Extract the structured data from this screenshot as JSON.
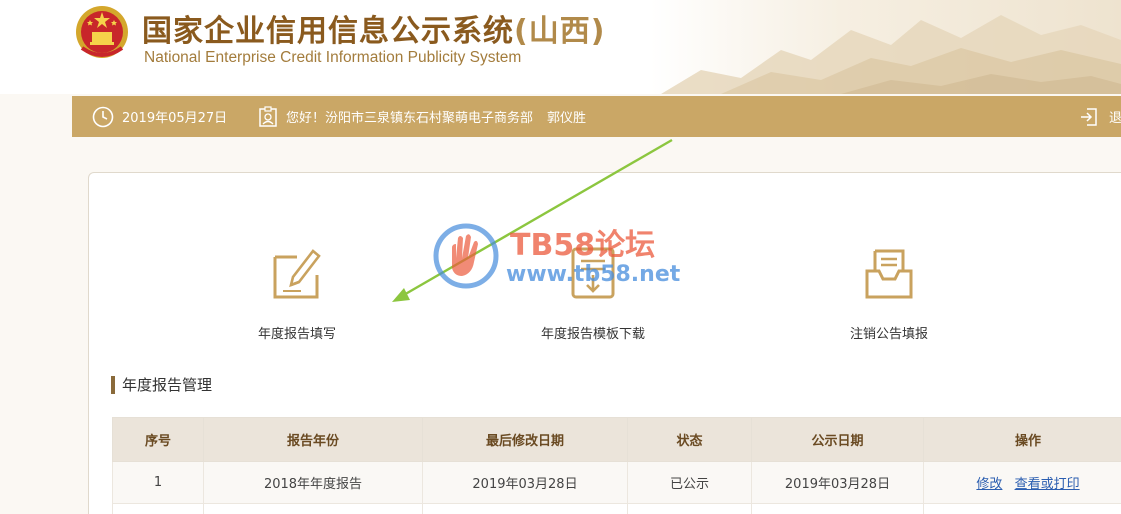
{
  "header": {
    "title_cn": "国家企业信用信息公示系统",
    "title_province": "(山西)",
    "title_en": "National Enterprise Credit Information Publicity System"
  },
  "infobar": {
    "date": "2019年05月27日",
    "greeting": "您好！汾阳市三泉镇东石村聚萌电子商务部",
    "person": "郭仪胜",
    "logout_label": "退"
  },
  "actions": {
    "annual_report_fill": "年度报告填写",
    "template_download": "年度报告模板下载",
    "cancel_notice_fill": "注销公告填报"
  },
  "section": {
    "title": "年度报告管理"
  },
  "table": {
    "headers": [
      "序号",
      "报告年份",
      "最后修改日期",
      "状态",
      "公示日期",
      "操作"
    ],
    "rows": [
      {
        "index": "1",
        "year": "2018年年度报告",
        "modified": "2019年03月28日",
        "status": "已公示",
        "publish_date": "2019年03月28日",
        "op_edit": "修改",
        "op_view": "查看或打印"
      }
    ]
  },
  "watermark": {
    "brand": "TB58论坛",
    "site": "www.tb58.net"
  },
  "colors": {
    "gold_bar": "#caa766",
    "title_brown": "#8a5a1e",
    "link_blue": "#2a5db0",
    "header_row": "#ebe4da",
    "arrow_green": "#8cc63f"
  }
}
